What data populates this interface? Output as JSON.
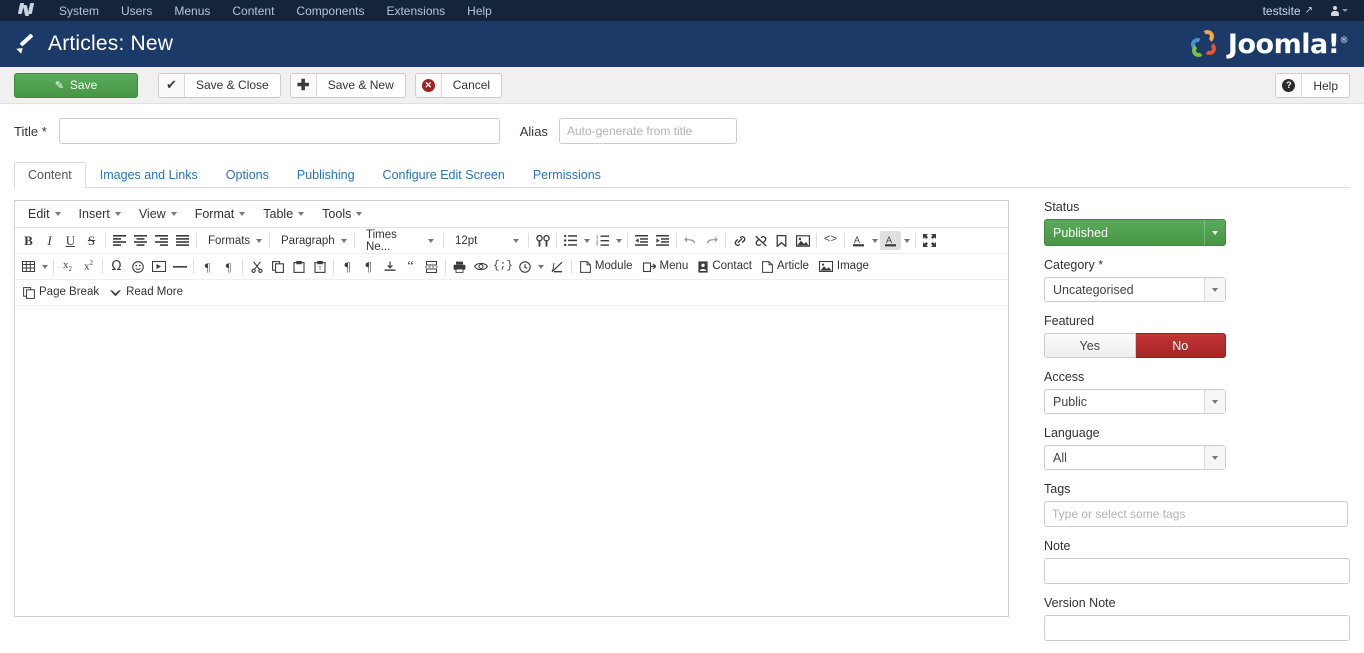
{
  "topbar": {
    "logo_name": "joomla-mark-icon",
    "menu": [
      "System",
      "Users",
      "Menus",
      "Content",
      "Components",
      "Extensions",
      "Help"
    ],
    "site_name": "testsite",
    "external_icon": "↗",
    "user_icon": "user-icon"
  },
  "header": {
    "title": "Articles: New",
    "brand": "Joomla!",
    "brand_registered": "®"
  },
  "toolbar": {
    "save": "Save",
    "save_close": "Save & Close",
    "save_new": "Save & New",
    "cancel": "Cancel",
    "help": "Help",
    "icons": {
      "save": "✎",
      "check": "✔",
      "plus": "✚",
      "cancel": "✕",
      "help": "?"
    }
  },
  "form": {
    "title_label": "Title *",
    "title_value": "",
    "title_placeholder": "",
    "alias_label": "Alias",
    "alias_value": "",
    "alias_placeholder": "Auto-generate from title"
  },
  "tabs": [
    {
      "label": "Content",
      "active": true
    },
    {
      "label": "Images and Links",
      "active": false
    },
    {
      "label": "Options",
      "active": false
    },
    {
      "label": "Publishing",
      "active": false
    },
    {
      "label": "Configure Edit Screen",
      "active": false
    },
    {
      "label": "Permissions",
      "active": false
    }
  ],
  "editor": {
    "menubar": [
      "Edit",
      "Insert",
      "View",
      "Format",
      "Table",
      "Tools"
    ],
    "font_family": "Times Ne...",
    "font_size": "12pt",
    "formats_label": "Formats",
    "paragraph_label": "Paragraph",
    "row1_icons": [
      "bold-icon",
      "italic-icon",
      "underline-icon",
      "strikethrough-icon",
      "align-left-icon",
      "align-center-icon",
      "align-right-icon",
      "align-justify-icon",
      "search-replace-icon",
      "bullet-list-icon",
      "numbered-list-icon",
      "outdent-icon",
      "indent-icon",
      "undo-icon",
      "redo-icon",
      "link-icon",
      "unlink-icon",
      "anchor-icon",
      "image-icon",
      "source-code-icon",
      "text-color-icon",
      "background-color-icon",
      "fullscreen-icon"
    ],
    "row2_icons": [
      "table-icon",
      "subscript-icon",
      "superscript-icon",
      "special-character-icon",
      "emoticon-icon",
      "media-icon",
      "horizontal-rule-icon",
      "ltr-icon",
      "rtl-icon",
      "cut-icon",
      "copy-icon",
      "paste-icon",
      "paste-text-icon",
      "show-invisible-characters-icon",
      "show-blocks-icon",
      "insert-template-icon",
      "blockquote-icon",
      "page-break-icon",
      "print-icon",
      "preview-icon",
      "nonbreaking-icon",
      "insert-datetime-icon",
      "remove-format-icon"
    ],
    "joomla_buttons": [
      {
        "label": "Module",
        "icon": "module-icon"
      },
      {
        "label": "Menu",
        "icon": "menu-icon"
      },
      {
        "label": "Contact",
        "icon": "contact-icon"
      },
      {
        "label": "Article",
        "icon": "article-icon"
      },
      {
        "label": "Image",
        "icon": "image-icon"
      }
    ],
    "row3_buttons": [
      {
        "label": "Page Break",
        "icon": "page-break-icon"
      },
      {
        "label": "Read More",
        "icon": "read-more-icon"
      }
    ],
    "content": ""
  },
  "sidebar": {
    "status": {
      "label": "Status",
      "value": "Published"
    },
    "category": {
      "label": "Category *",
      "value": "Uncategorised"
    },
    "featured": {
      "label": "Featured",
      "yes": "Yes",
      "no": "No",
      "selected": "No"
    },
    "access": {
      "label": "Access",
      "value": "Public"
    },
    "language": {
      "label": "Language",
      "value": "All"
    },
    "tags": {
      "label": "Tags",
      "value": "",
      "placeholder": "Type or select some tags"
    },
    "note": {
      "label": "Note",
      "value": "",
      "placeholder": ""
    },
    "version_note": {
      "label": "Version Note",
      "value": "",
      "placeholder": ""
    }
  },
  "colors": {
    "topbar": "#13243b",
    "header": "#1b3a67",
    "save_green": "#4e9e4e",
    "status_green": "#4e9e4e",
    "featured_red": "#b32b2b",
    "link_blue": "#2a73b7"
  }
}
